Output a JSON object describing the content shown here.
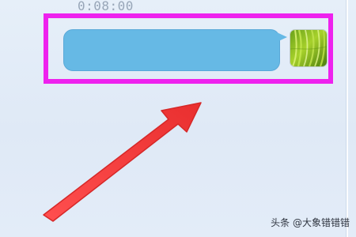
{
  "chat": {
    "timestamp": "0:08:00",
    "message": {
      "text": "",
      "bubble_color": "#66b9e5",
      "direction": "outgoing"
    },
    "avatar": {
      "icon": "grass-avatar-icon",
      "colors": [
        "#5f8f11",
        "#8fbe22",
        "#c6e556"
      ]
    }
  },
  "annotation": {
    "highlight_color": "#ee22ee",
    "arrow_color": "#f33a3a"
  },
  "watermark": {
    "text": "头条 @大象错错错"
  }
}
